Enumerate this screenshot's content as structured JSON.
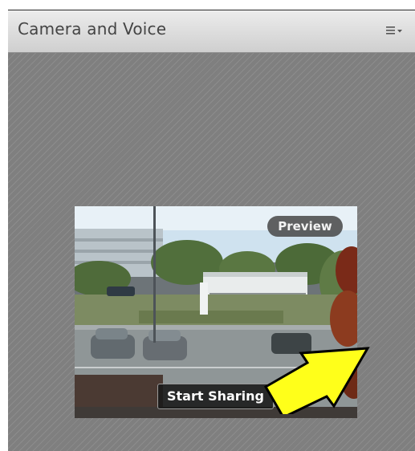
{
  "panel": {
    "title": "Camera and Voice",
    "menu_icon": "menu-dropdown-icon"
  },
  "video": {
    "preview_label": "Preview",
    "start_sharing_label": "Start Sharing"
  },
  "annotation": {
    "arrow_color": "#ffff1a",
    "icon": "pointer-arrow-icon"
  },
  "colors": {
    "header_bg": "#dcdcdc",
    "body_bg": "#7f7f7f",
    "button_bg": "#1a1a1a"
  }
}
